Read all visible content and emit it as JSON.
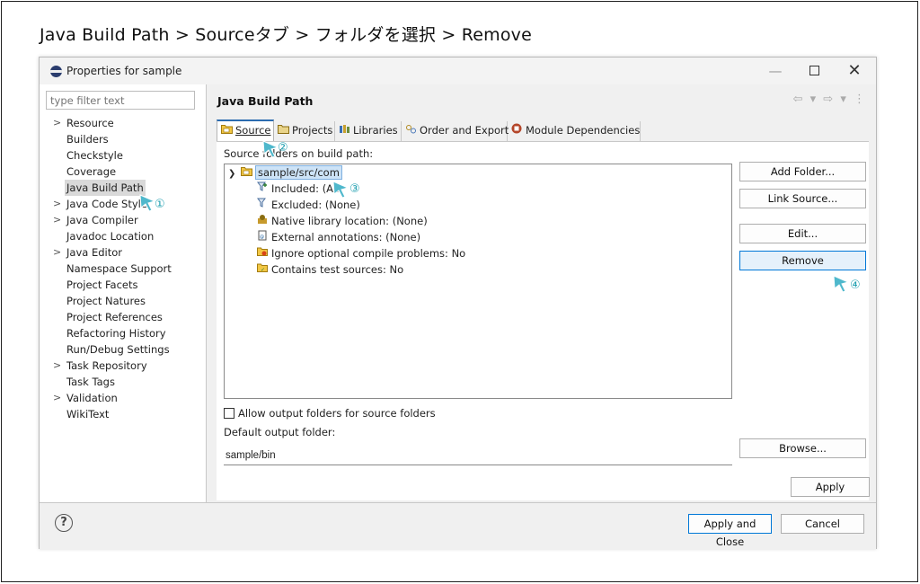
{
  "caption": "Java Build Path > Sourceタブ > フォルダを選択 > Remove",
  "window": {
    "title": "Properties for sample",
    "minimize": "—",
    "close": "✕"
  },
  "left": {
    "filter_placeholder": "type filter text",
    "items": [
      {
        "label": "Resource",
        "expandable": true
      },
      {
        "label": "Builders",
        "expandable": false
      },
      {
        "label": "Checkstyle",
        "expandable": false
      },
      {
        "label": "Coverage",
        "expandable": false
      },
      {
        "label": "Java Build Path",
        "expandable": false,
        "selected": true
      },
      {
        "label": "Java Code Style",
        "expandable": true
      },
      {
        "label": "Java Compiler",
        "expandable": true
      },
      {
        "label": "Javadoc Location",
        "expandable": false
      },
      {
        "label": "Java Editor",
        "expandable": true
      },
      {
        "label": "Namespace Support",
        "expandable": false
      },
      {
        "label": "Project Facets",
        "expandable": false
      },
      {
        "label": "Project Natures",
        "expandable": false
      },
      {
        "label": "Project References",
        "expandable": false
      },
      {
        "label": "Refactoring History",
        "expandable": false
      },
      {
        "label": "Run/Debug Settings",
        "expandable": false
      },
      {
        "label": "Task Repository",
        "expandable": true
      },
      {
        "label": "Task Tags",
        "expandable": false
      },
      {
        "label": "Validation",
        "expandable": true
      },
      {
        "label": "WikiText",
        "expandable": false
      }
    ]
  },
  "right": {
    "title": "Java Build Path",
    "nav": "⇦ ▾ ⇨ ▾ ⋮",
    "tabs": [
      {
        "label": "Source",
        "icon": "source-folder-icon",
        "active": true
      },
      {
        "label": "Projects",
        "icon": "projects-icon"
      },
      {
        "label": "Libraries",
        "icon": "libraries-icon"
      },
      {
        "label": "Order and Export",
        "icon": "order-export-icon"
      },
      {
        "label": "Module Dependencies",
        "icon": "module-icon"
      }
    ],
    "source_label": "Source folders on build path:",
    "tree": {
      "root": "sample/src/com",
      "children": [
        {
          "label": "Included: (All)",
          "icon": "filter-included-icon"
        },
        {
          "label": "Excluded: (None)",
          "icon": "filter-excluded-icon"
        },
        {
          "label": "Native library location: (None)",
          "icon": "native-library-icon"
        },
        {
          "label": "External annotations: (None)",
          "icon": "annotations-icon"
        },
        {
          "label": "Ignore optional compile problems: No",
          "icon": "ignore-problems-icon"
        },
        {
          "label": "Contains test sources: No",
          "icon": "test-sources-icon"
        }
      ]
    },
    "buttons": {
      "add_folder": "Add Folder...",
      "link_source": "Link Source...",
      "edit": "Edit...",
      "remove": "Remove",
      "browse": "Browse...",
      "apply": "Apply"
    },
    "allow_output": "Allow output folders for source folders",
    "default_output_label": "Default output folder:",
    "default_output_value": "sample/bin"
  },
  "bottom": {
    "help": "?",
    "apply_close": "Apply and Close",
    "cancel": "Cancel"
  },
  "annotations": {
    "m1": "①",
    "m2": "②",
    "m3": "③",
    "m4": "④",
    "color": "#1f9fb0"
  }
}
